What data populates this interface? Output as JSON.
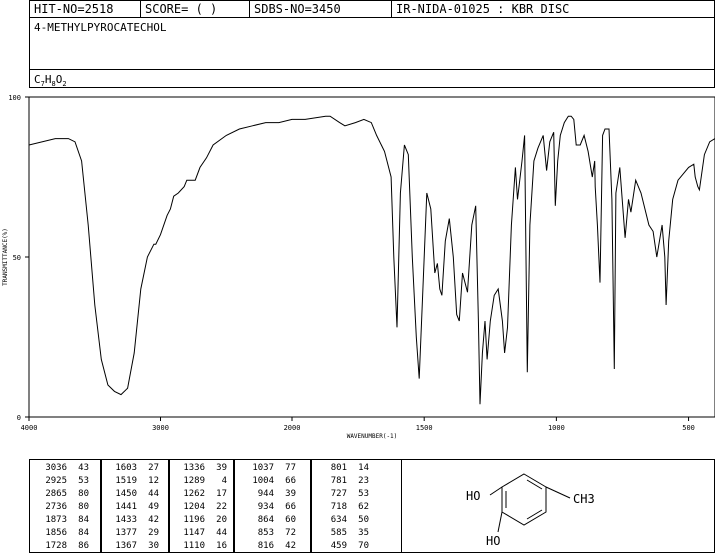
{
  "header": {
    "hit": "HIT-NO=2518",
    "score": "SCORE=  (   )",
    "sdbs": "SDBS-NO=3450",
    "method": "IR-NIDA-01025 : KBR DISC"
  },
  "compound": {
    "name": "4-METHYLPYROCATECHOL",
    "formula": "C7H8O2",
    "formula_parts": [
      "C",
      "7",
      "H",
      "8",
      "O",
      "2"
    ]
  },
  "chart_data": {
    "type": "line",
    "title": "",
    "xlabel": "WAVENUMBER(-1)",
    "ylabel": "TRANSMITTANCE(%)",
    "xlim": [
      4000,
      400
    ],
    "ylim": [
      0,
      100
    ],
    "x_ticks": [
      4000,
      3000,
      2000,
      1500,
      1000,
      500
    ],
    "y_ticks": [
      0,
      50,
      100
    ],
    "x_tick_labels": [
      "4000",
      "3000",
      "2000",
      "1500",
      "1000",
      "500"
    ],
    "y_tick_labels": [
      "0",
      "50",
      "100"
    ],
    "grid": false,
    "series": [
      {
        "x": [
          4000,
          3800,
          3700,
          3650,
          3600,
          3550,
          3500,
          3450,
          3400,
          3350,
          3300,
          3250,
          3200,
          3150,
          3100,
          3050,
          3036,
          3000,
          2950,
          2925,
          2900,
          2865,
          2820,
          2800,
          2736,
          2700,
          2650,
          2600,
          2500,
          2400,
          2300,
          2200,
          2100,
          2000,
          1950,
          1873,
          1856,
          1820,
          1800,
          1760,
          1728,
          1700,
          1680,
          1650,
          1625,
          1615,
          1603,
          1590,
          1575,
          1560,
          1545,
          1530,
          1519,
          1505,
          1490,
          1475,
          1460,
          1450,
          1441,
          1433,
          1420,
          1405,
          1390,
          1377,
          1367,
          1355,
          1336,
          1320,
          1305,
          1295,
          1289,
          1280,
          1270,
          1262,
          1250,
          1235,
          1220,
          1204,
          1196,
          1185,
          1170,
          1155,
          1147,
          1130,
          1120,
          1110,
          1100,
          1085,
          1070,
          1050,
          1037,
          1025,
          1010,
          1004,
          995,
          985,
          970,
          955,
          944,
          934,
          925,
          910,
          895,
          880,
          864,
          855,
          853,
          845,
          835,
          825,
          816,
          801,
          790,
          781,
          775,
          760,
          740,
          727,
          718,
          700,
          680,
          650,
          634,
          620,
          600,
          590,
          585,
          575,
          560,
          540,
          520,
          500,
          480,
          475,
          465,
          459,
          440,
          420,
          400
        ],
        "y": [
          85,
          87,
          87,
          86,
          80,
          60,
          35,
          18,
          10,
          8,
          7,
          9,
          20,
          40,
          50,
          54,
          54,
          57,
          63,
          65,
          69,
          70,
          72,
          74,
          74,
          78,
          81,
          85,
          88,
          90,
          91,
          92,
          92,
          93,
          93,
          94,
          94,
          92,
          91,
          92,
          93,
          92,
          88,
          83,
          75,
          50,
          28,
          70,
          85,
          82,
          50,
          25,
          12,
          40,
          70,
          65,
          45,
          48,
          40,
          38,
          55,
          62,
          50,
          32,
          30,
          45,
          39,
          60,
          66,
          30,
          4,
          20,
          30,
          18,
          30,
          38,
          40,
          30,
          20,
          28,
          60,
          78,
          68,
          80,
          88,
          14,
          60,
          80,
          84,
          88,
          77,
          86,
          89,
          66,
          80,
          88,
          92,
          94,
          94,
          93,
          85,
          85,
          88,
          83,
          75,
          80,
          72,
          60,
          42,
          88,
          90,
          90,
          68,
          15,
          70,
          78,
          56,
          68,
          64,
          74,
          70,
          60,
          58,
          50,
          60,
          50,
          35,
          55,
          68,
          74,
          76,
          78,
          79,
          75,
          72,
          71,
          82,
          86,
          87
        ]
      }
    ]
  },
  "peaks": {
    "col1": [
      [
        "3036",
        "43"
      ],
      [
        "2925",
        "53"
      ],
      [
        "2865",
        "80"
      ],
      [
        "2736",
        "80"
      ],
      [
        "1873",
        "84"
      ],
      [
        "1856",
        "84"
      ],
      [
        "1728",
        "86"
      ]
    ],
    "col2": [
      [
        "1603",
        "27"
      ],
      [
        "1519",
        "12"
      ],
      [
        "1450",
        "44"
      ],
      [
        "1441",
        "49"
      ],
      [
        "1433",
        "42"
      ],
      [
        "1377",
        "29"
      ],
      [
        "1367",
        "30"
      ]
    ],
    "col3": [
      [
        "1336",
        "39"
      ],
      [
        "1289",
        "4"
      ],
      [
        "1262",
        "17"
      ],
      [
        "1204",
        "22"
      ],
      [
        "1196",
        "20"
      ],
      [
        "1147",
        "44"
      ],
      [
        "1110",
        "16"
      ]
    ],
    "col4": [
      [
        "1037",
        "77"
      ],
      [
        "1004",
        "66"
      ],
      [
        "944",
        "39"
      ],
      [
        "934",
        "66"
      ],
      [
        "864",
        "60"
      ],
      [
        "853",
        "72"
      ],
      [
        "816",
        "42"
      ]
    ],
    "col5": [
      [
        "801",
        "14"
      ],
      [
        "781",
        "23"
      ],
      [
        "727",
        "53"
      ],
      [
        "718",
        "62"
      ],
      [
        "634",
        "50"
      ],
      [
        "585",
        "35"
      ],
      [
        "459",
        "70"
      ]
    ]
  },
  "structure": {
    "labels": [
      "HO",
      "HO",
      "CH3"
    ]
  }
}
